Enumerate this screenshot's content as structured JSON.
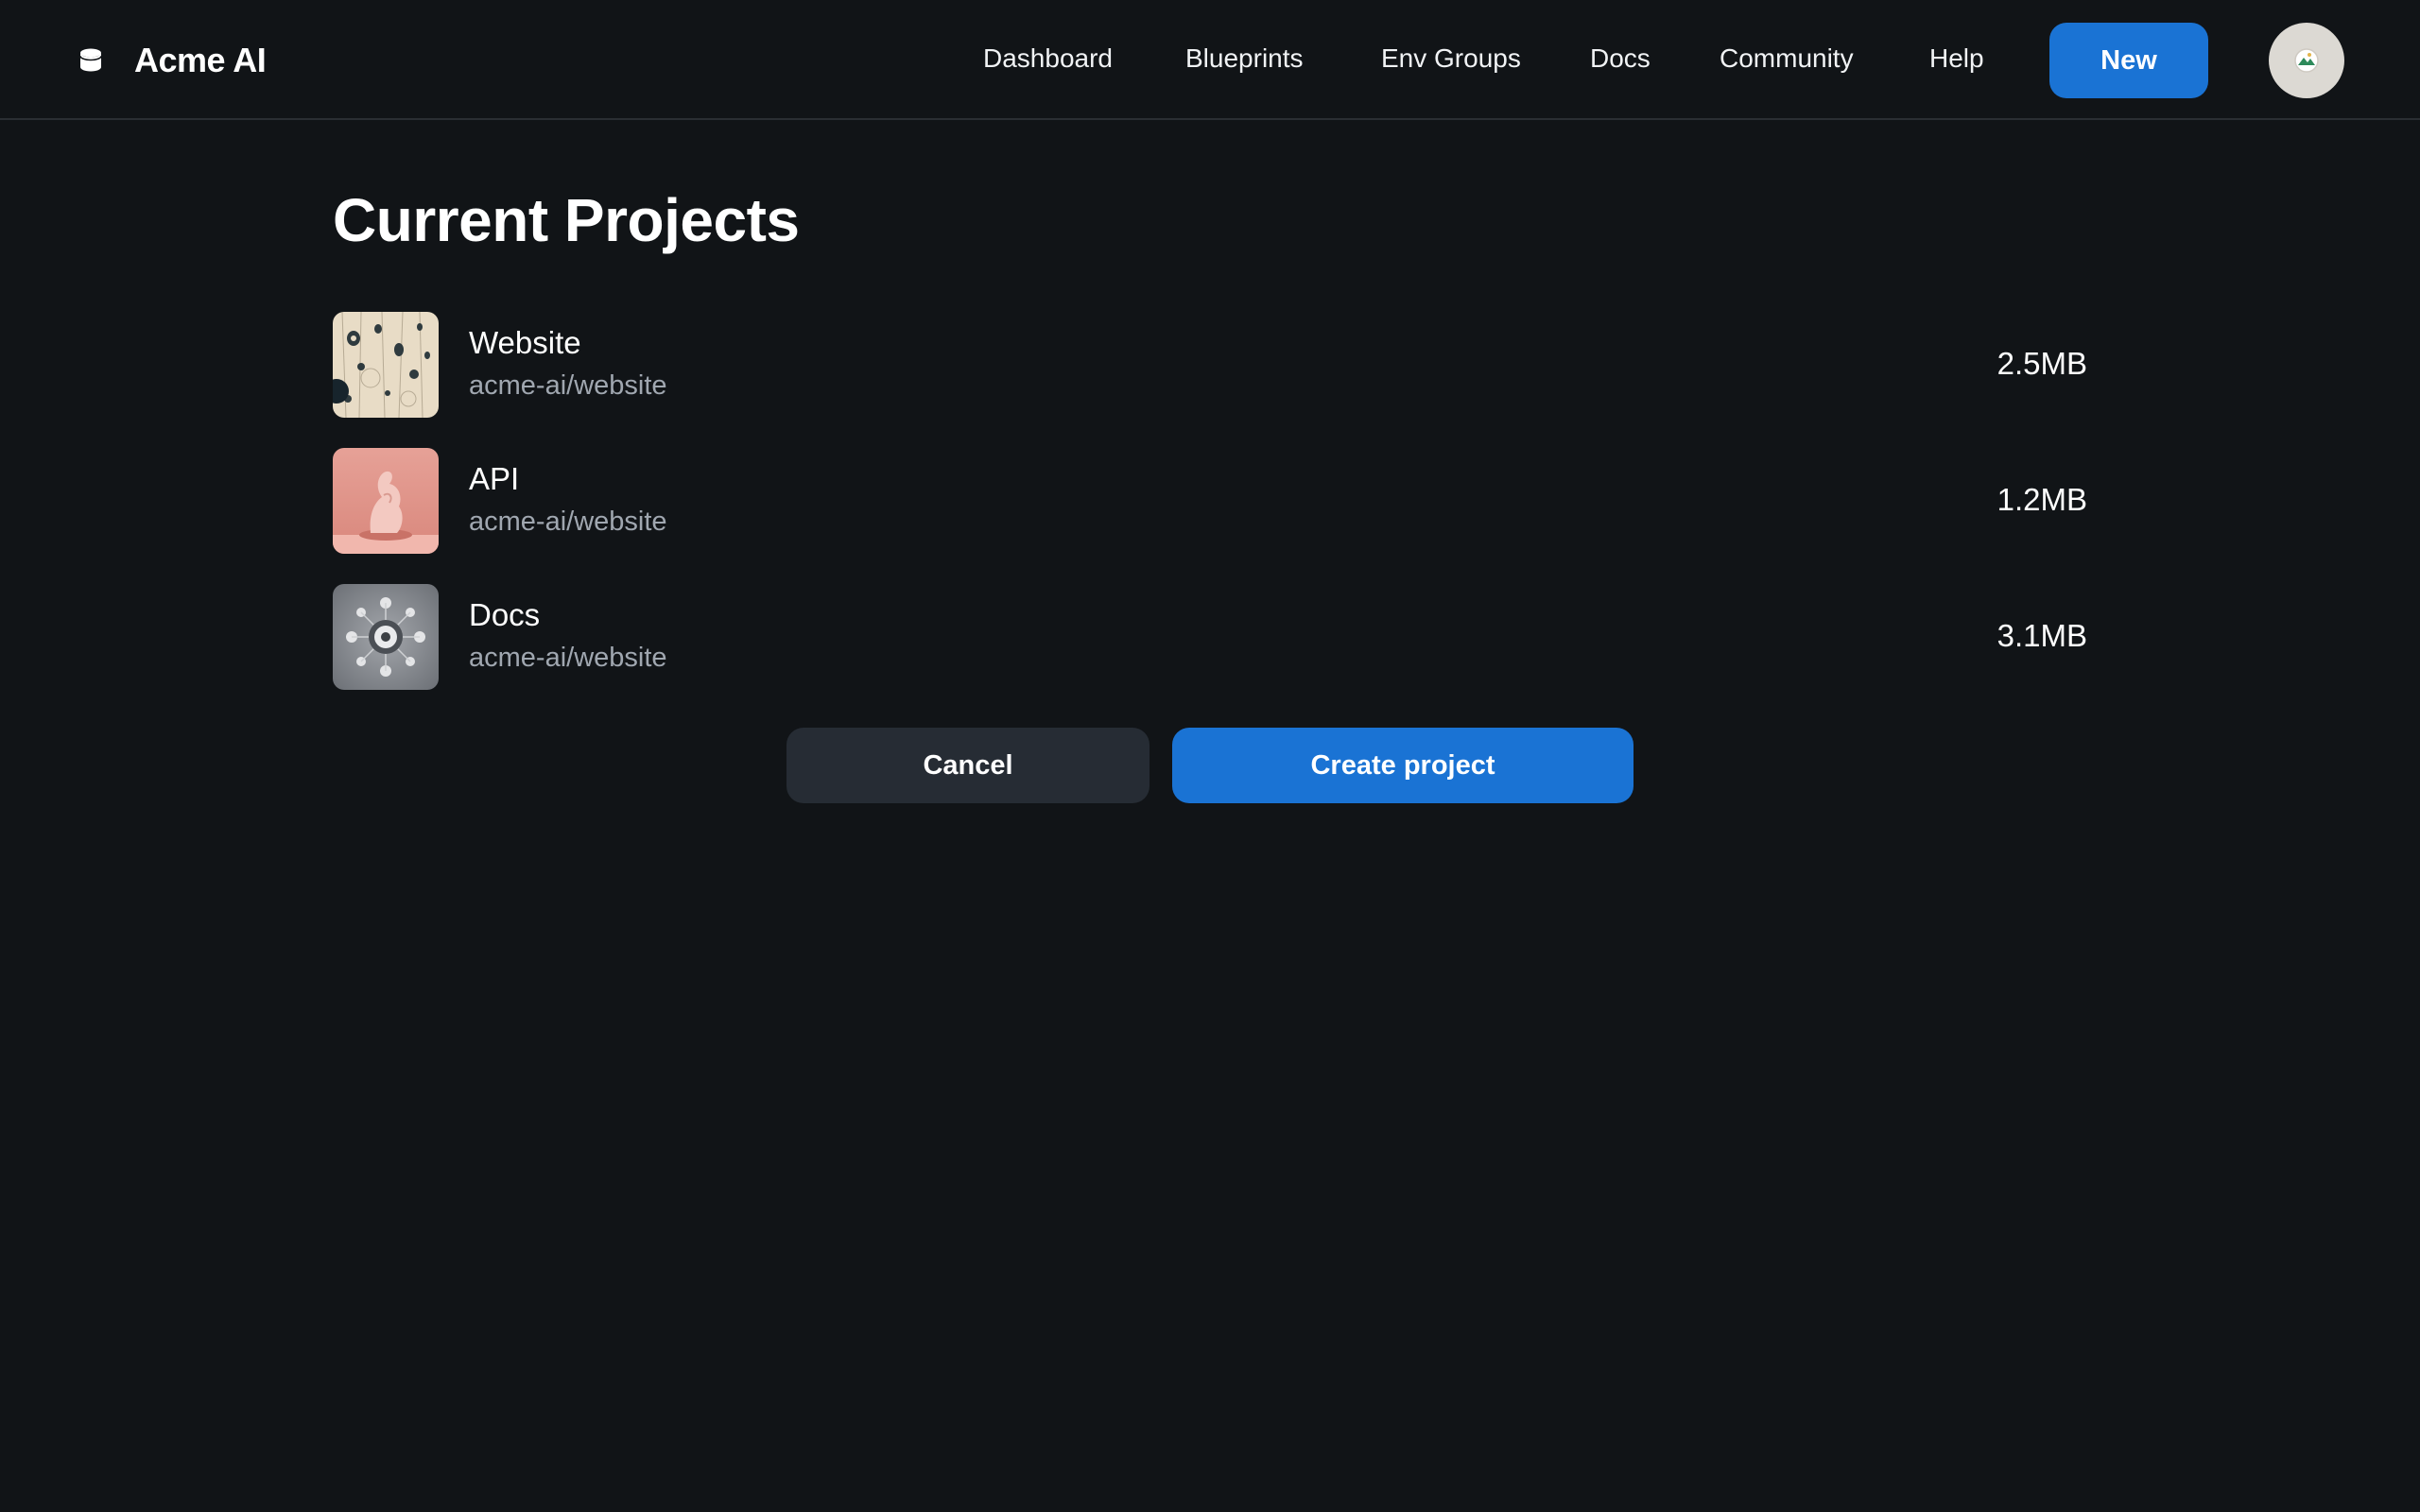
{
  "header": {
    "brand_name": "Acme AI",
    "brand_icon": "database-icon",
    "nav": [
      {
        "label": "Dashboard"
      },
      {
        "label": "Blueprints"
      },
      {
        "label": "Env Groups"
      },
      {
        "label": "Docs"
      },
      {
        "label": "Community"
      },
      {
        "label": "Help"
      }
    ],
    "new_button_label": "New",
    "avatar_icon": "user-avatar"
  },
  "main": {
    "title": "Current Projects",
    "projects": [
      {
        "name": "Website",
        "repo": "acme-ai/website",
        "size": "2.5MB",
        "thumbnail": "abstract-pattern-image"
      },
      {
        "name": "API",
        "repo": "acme-ai/website",
        "size": "1.2MB",
        "thumbnail": "pink-sculpture-image"
      },
      {
        "name": "Docs",
        "repo": "acme-ai/website",
        "size": "3.1MB",
        "thumbnail": "gray-mechanical-image"
      }
    ],
    "cancel_label": "Cancel",
    "create_label": "Create project"
  },
  "colors": {
    "background": "#111417",
    "primary": "#1a73d4",
    "secondary_button": "#262c34",
    "muted_text": "#a0a7b0",
    "divider": "#2a2e33"
  }
}
